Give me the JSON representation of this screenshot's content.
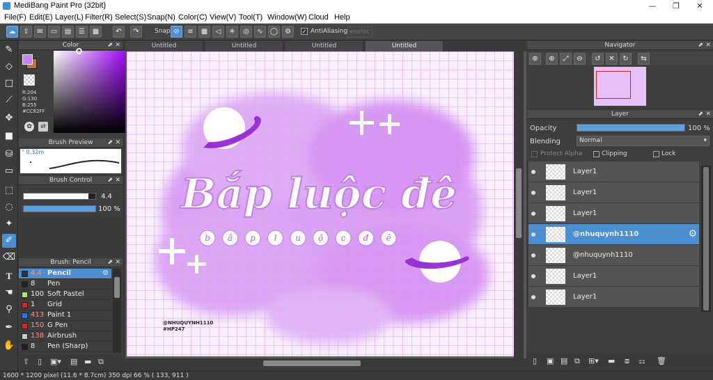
{
  "window": {
    "title": "MediBang Paint Pro (32bit)",
    "minimize": "—",
    "maximize": "❐",
    "close": "✕"
  },
  "menu": [
    "File(F)",
    "Edit(E)",
    "Layer(L)",
    "Filter(R)",
    "Select(S)",
    "Snap(N)",
    "Color(C)",
    "View(V)",
    "Tool(T)",
    "Window(W)",
    "Cloud",
    "Help"
  ],
  "toolbar": {
    "snap_label": "Snap",
    "antialiasing_label": "AntiAliasing",
    "deselect_label": "eselec"
  },
  "color_panel": {
    "title": "Color",
    "r": "R:204",
    "g": "G:130",
    "b": "B:255",
    "hex": "#CC82FF",
    "primary_color": "#CC82FF",
    "secondary_color": "#C8703A"
  },
  "brush_preview": {
    "title": "Brush Preview",
    "size": "0.32m"
  },
  "brush_control": {
    "title": "Brush Control",
    "size_value": "4.4",
    "size_fraction": 0.9,
    "opacity_value": "100 %",
    "opacity_fraction": 1.0
  },
  "brush_list": {
    "title": "Brush: Pencil",
    "items": [
      {
        "size": "4.4",
        "name": "Pencil",
        "color": "#333333"
      },
      {
        "size": "8",
        "name": "Pen",
        "color": "#222222"
      },
      {
        "size": "100",
        "name": "Soft Pastel",
        "color": "#b7e36a"
      },
      {
        "size": "1",
        "name": "Grid",
        "color": "#e02020"
      },
      {
        "size": "413",
        "name": "Paint 1",
        "color": "#3070e0"
      },
      {
        "size": "150",
        "name": "G Pen",
        "color": "#e02020"
      },
      {
        "size": "138",
        "name": "Airbrush",
        "color": "#cccccc"
      },
      {
        "size": "8",
        "name": "Pen (Sharp)",
        "color": "#222222"
      }
    ]
  },
  "tabs": [
    "Untitled",
    "Untitled",
    "Untitled",
    "Untitled"
  ],
  "artwork": {
    "headline": "Bắp luộc đê",
    "sub_letters": [
      "b",
      "ắ",
      "p",
      "l",
      "u",
      "ộ",
      "c",
      "đ",
      "ê"
    ],
    "signature_line1": "@NHUQUYNH1110",
    "signature_line2": "#HP247"
  },
  "navigator": {
    "title": "Navigator"
  },
  "layer_panel": {
    "title": "Layer",
    "opacity_label": "Opacity",
    "opacity_value": "100 %",
    "opacity_fraction": 1.0,
    "blending_label": "Blending",
    "blending_value": "Normal",
    "protect_alpha_label": "Protect Alpha",
    "clipping_label": "Clipping",
    "lock_label": "Lock",
    "layers": [
      {
        "name": "Layer1"
      },
      {
        "name": "Layer1"
      },
      {
        "name": "Layer1"
      },
      {
        "name": "@nhuquynh1110"
      },
      {
        "name": "@nhuquynh1110"
      },
      {
        "name": "Layer1"
      },
      {
        "name": "Layer1"
      }
    ]
  },
  "status": "1600 * 1200 pixel   (11.6 * 8.7cm)   350 dpi   66 %   ( 133, 911 )"
}
